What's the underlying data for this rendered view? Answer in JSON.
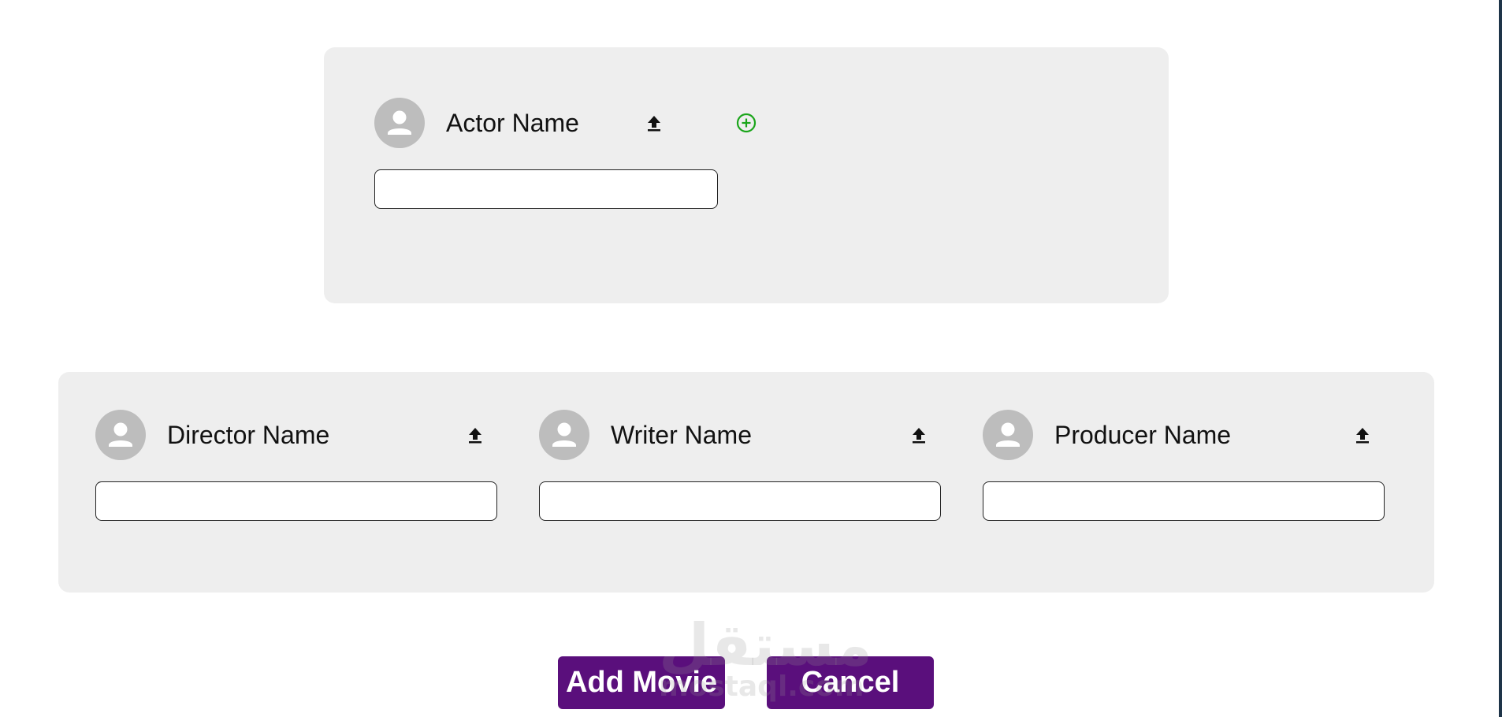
{
  "actor": {
    "label": "Actor Name",
    "input_value": "",
    "avatar_icon": "person-avatar-icon",
    "upload_icon": "upload-icon",
    "add_icon": "add-circle-icon",
    "add_icon_color": "#1aa51a"
  },
  "crew": {
    "director": {
      "label": "Director Name",
      "input_value": ""
    },
    "writer": {
      "label": "Writer Name",
      "input_value": ""
    },
    "producer": {
      "label": "Producer Name",
      "input_value": ""
    }
  },
  "actions": {
    "add_movie_label": "Add Movie",
    "cancel_label": "Cancel"
  },
  "watermark": {
    "arabic": "مستقل",
    "latin": "mostaql.com"
  },
  "colors": {
    "panel_background": "#eeeeee",
    "avatar_background": "#bdbdbd",
    "button_primary": "#5a0f7c",
    "button_text": "#ffffff"
  }
}
